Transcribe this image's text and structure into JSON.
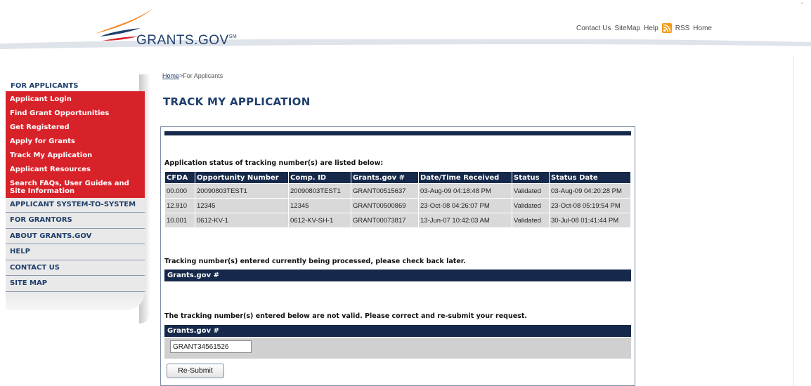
{
  "header": {
    "logo_text": "GRANTS.GOV",
    "logo_mark": "SM",
    "links": {
      "contact": "Contact Us",
      "sitemap": "SiteMap",
      "help": "Help",
      "rss": "RSS",
      "home": "Home"
    },
    "colors": {
      "brand_blue": "#1f3f6b",
      "accent_red": "#d8222a",
      "rss_orange": "#f29a1c"
    }
  },
  "sidebar": {
    "heading": "FOR APPLICANTS",
    "red_items": [
      {
        "label": "Applicant Login"
      },
      {
        "label": "Find Grant Opportunities"
      },
      {
        "label": "Get Registered"
      },
      {
        "label": "Apply for Grants"
      },
      {
        "label": "Track My Application"
      },
      {
        "label": "Applicant Resources"
      },
      {
        "label": "Search FAQs, User Guides and Site Information"
      }
    ],
    "grey_items": [
      {
        "label": "APPLICANT SYSTEM-TO-SYSTEM"
      },
      {
        "label": "FOR GRANTORS"
      },
      {
        "label": "ABOUT GRANTS.GOV"
      },
      {
        "label": "HELP"
      },
      {
        "label": "CONTACT US"
      },
      {
        "label": "SITE MAP"
      }
    ]
  },
  "breadcrumb": {
    "home": "Home",
    "separator": ">",
    "current": "For Applicants"
  },
  "page_title": "TRACK MY APPLICATION",
  "status_section": {
    "intro": "Application status of tracking number(s) are listed below:",
    "columns": [
      "CFDA",
      "Opportunity Number",
      "Comp. ID",
      "Grants.gov #",
      "Date/Time Received",
      "Status",
      "Status Date"
    ],
    "rows": [
      [
        "00.000",
        "20090803TEST1",
        "20090803TEST1",
        "GRANT00515637",
        "03-Aug-09 04:18:48 PM",
        "Validated",
        "03-Aug-09 04:20:28 PM"
      ],
      [
        "12.910",
        "12345",
        "12345",
        "GRANT00500869",
        "23-Oct-08 04:26:07 PM",
        "Validated",
        "23-Oct-08 05:19:54 PM"
      ],
      [
        "10.001",
        "0612-KV-1",
        "0612-KV-SH-1",
        "GRANT00073817",
        "13-Jun-07 10:42:03 AM",
        "Validated",
        "30-Jul-08 01:41:44 PM"
      ]
    ]
  },
  "processing_section": {
    "intro": "Tracking number(s) entered currently being processed, please check back later.",
    "column": "Grants.gov #"
  },
  "invalid_section": {
    "intro": "The tracking number(s) entered below are not valid. Please correct and re-submit your request.",
    "column": "Grants.gov #",
    "input_value": "GRANT34561526",
    "button_label": "Re-Submit"
  }
}
